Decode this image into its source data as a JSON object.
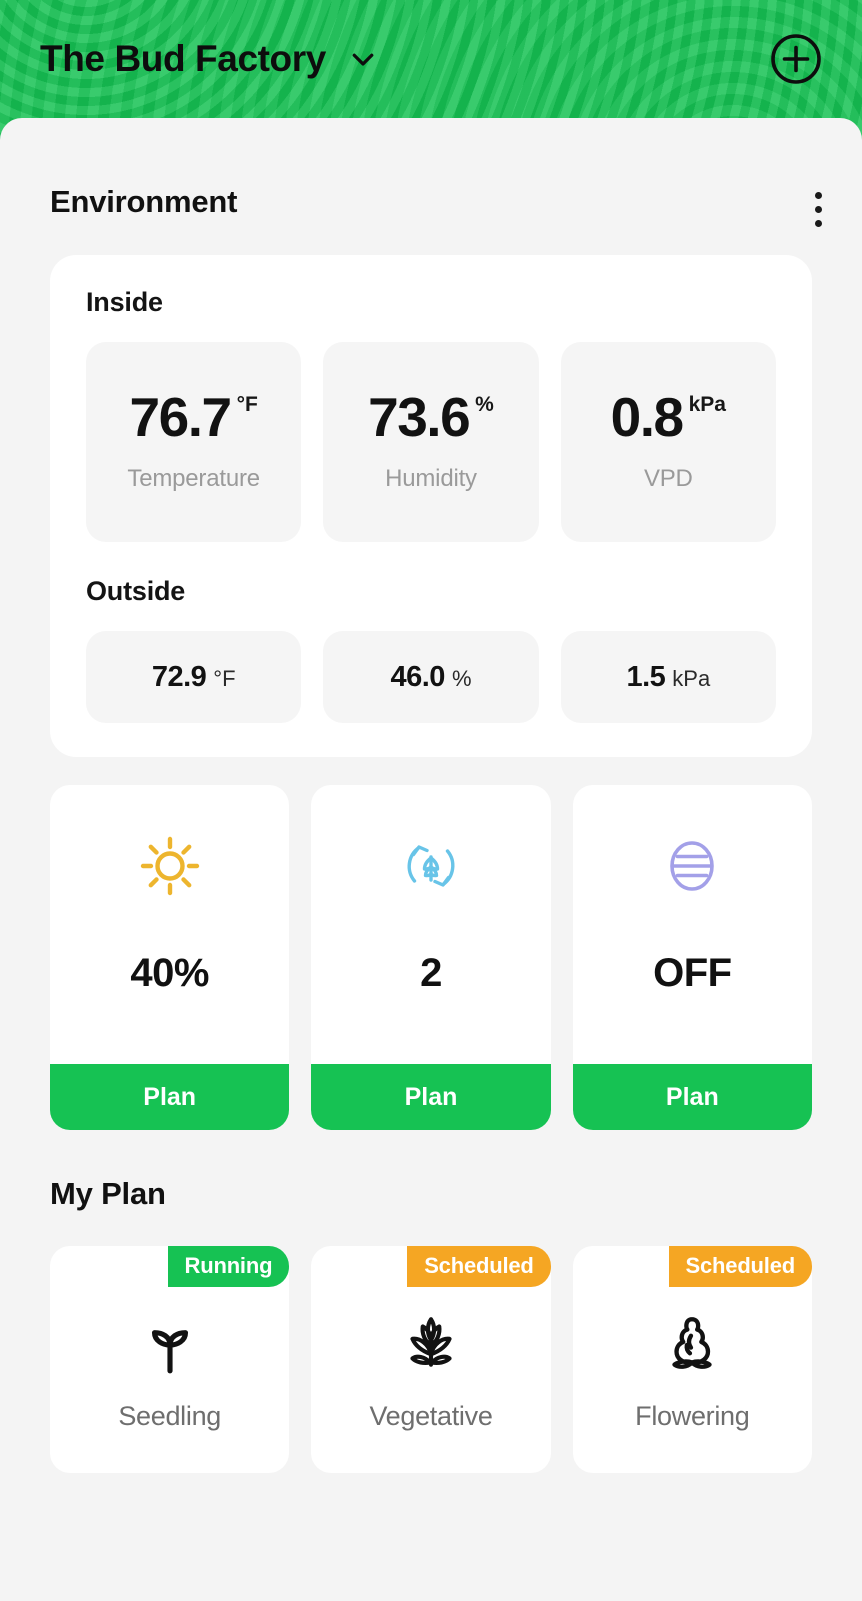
{
  "header": {
    "title": "The Bud Factory",
    "chevron_icon": "chevron-down-icon",
    "add_icon": "plus-circle-icon"
  },
  "environment": {
    "section_title": "Environment",
    "menu_icon": "kebab-menu-icon",
    "inside": {
      "label": "Inside",
      "metrics": [
        {
          "value": "76.7",
          "unit": "°F",
          "name": "Temperature"
        },
        {
          "value": "73.6",
          "unit": "%",
          "name": "Humidity"
        },
        {
          "value": "0.8",
          "unit": "kPa",
          "name": "VPD"
        }
      ]
    },
    "outside": {
      "label": "Outside",
      "metrics": [
        {
          "value": "72.9",
          "unit": "°F"
        },
        {
          "value": "46.0",
          "unit": "%"
        },
        {
          "value": "1.5",
          "unit": "kPa"
        }
      ]
    }
  },
  "devices": [
    {
      "icon": "sun-icon",
      "value": "40%",
      "plan_label": "Plan",
      "color": "#edb52e"
    },
    {
      "icon": "circulation-leaf-icon",
      "value": "2",
      "plan_label": "Plan",
      "color": "#68c4e8"
    },
    {
      "icon": "dehumidifier-icon",
      "value": "OFF",
      "plan_label": "Plan",
      "color": "#a3a0e8"
    }
  ],
  "my_plan": {
    "title": "My Plan",
    "stages": [
      {
        "badge": "Running",
        "badge_state": "running",
        "icon": "sprout-icon",
        "name": "Seedling"
      },
      {
        "badge": "Scheduled",
        "badge_state": "scheduled",
        "icon": "cannabis-leaf-icon",
        "name": "Vegetative"
      },
      {
        "badge": "Scheduled",
        "badge_state": "scheduled",
        "icon": "bud-icon",
        "name": "Flowering"
      }
    ]
  },
  "colors": {
    "brand_green": "#16c253",
    "badge_orange": "#f5a623",
    "page_background": "#f4f4f4",
    "card_background": "#ffffff",
    "tile_background": "#f5f5f5"
  }
}
